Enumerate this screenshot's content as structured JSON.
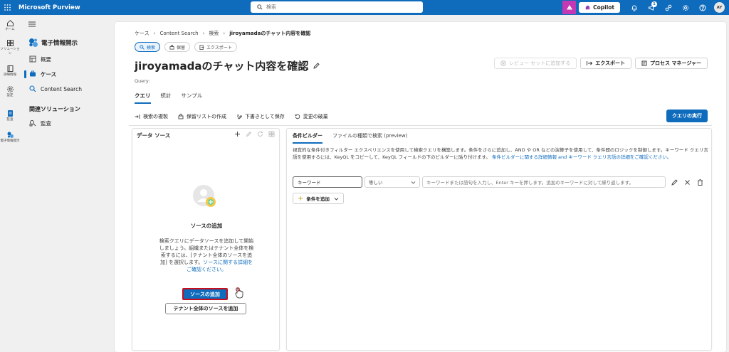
{
  "app": {
    "brand": "Microsoft Purview",
    "search_placeholder": "検索",
    "copilot_label": "Copilot",
    "notification_count": "1",
    "user_initials": "AY"
  },
  "rail": [
    {
      "label": "ホーム",
      "icon": "home-icon"
    },
    {
      "label": "ソリューション",
      "icon": "grid-icon"
    },
    {
      "label": "詳細情報",
      "icon": "book-icon"
    },
    {
      "label": "設定",
      "icon": "gear-icon"
    },
    {
      "label": "監査",
      "icon": "audit-icon"
    },
    {
      "label": "電子情報開示",
      "icon": "ediscovery-icon"
    }
  ],
  "nav": {
    "title": "電子情報開示",
    "items": [
      {
        "label": "概要",
        "icon": "overview-icon",
        "selected": false
      },
      {
        "label": "ケース",
        "icon": "case-icon",
        "selected": true
      },
      {
        "label": "Content Search",
        "icon": "search-icon",
        "selected": false
      }
    ],
    "section_title": "関連ソリューション",
    "section_items": [
      {
        "label": "監査",
        "icon": "audit-icon"
      }
    ]
  },
  "breadcrumb": [
    "ケース",
    "Content Search",
    "検索",
    "jiroyamadaのチャット内容を確認"
  ],
  "pills": [
    {
      "label": "検索",
      "active": true
    },
    {
      "label": "保留",
      "active": false
    },
    {
      "label": "エクスポート",
      "active": false
    }
  ],
  "page_title": "jiroyamadaのチャット内容を確認",
  "actions": {
    "review_set": "レビュー セットに追加する",
    "export": "エクスポート",
    "process_manager": "プロセス マネージャー"
  },
  "query_label": "Query:",
  "tabs": [
    "クエリ",
    "統計",
    "サンプル"
  ],
  "commands": [
    "検索の複製",
    "保留リストの作成",
    "下書きとして保存",
    "変更の破棄"
  ],
  "run_query": "クエリの実行",
  "data_source": {
    "heading": "データ ソース",
    "empty_title": "ソースの追加",
    "body_text": "検索クエリにデータソースを追加して開始しましょう。組織またはテナント全体を検索するには、[テナント全体のソースを追加] を選択します。",
    "body_link": "ソースに関する詳細をご確認ください。",
    "add_source": "ソースの追加",
    "add_tenant_source": "テナント全体のソースを追加"
  },
  "builder": {
    "tabs": [
      "条件ビルダー",
      "ファイルの種類で検索 (preview)"
    ],
    "desc_1": "視覚的な条件付きフィルター エクスペリエンスを使用して検索クエリを構築します。条件をさらに追加し、AND や OR などの演算子を使用して、条件間のロジックを制御します。キーワード クエリ言語を使用するには、KeyQL をコピーして、KeyQL フィールドの下のビルダーに貼り付けます。",
    "desc_link": "条件ビルダーに関する詳細情報 and キーワード クエリ言語の詳細をご確認ください。",
    "condition_key": "キーワード",
    "condition_op": "等しい",
    "condition_value_placeholder": "キーワードまたは語句を入力し、Enter キーを押します。追加のキーワードに対して繰り返します。",
    "add_condition": "条件を追加"
  },
  "colors": {
    "brand": "#0f6cbd",
    "accent_purple": "#c239b3",
    "focus_red": "#c50f1f"
  }
}
